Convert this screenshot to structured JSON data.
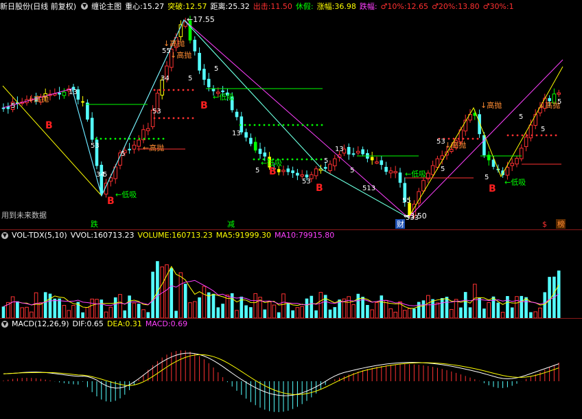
{
  "main_header": {
    "stock_name": "新日股份(日线 前复权)",
    "indicator": "缠论主图",
    "items": [
      {
        "label": "重心:",
        "value": "15.27",
        "color": "#ffffff"
      },
      {
        "label": "突破:",
        "value": "12.57",
        "color": "#ffff00"
      },
      {
        "label": "距离:",
        "value": "25.32",
        "color": "#ffffff"
      },
      {
        "label": "出击:",
        "value": "11.50",
        "color": "#ff3030"
      },
      {
        "label": "休假:",
        "value": "",
        "color": "#00ff00"
      },
      {
        "label": "涨幅:",
        "value": "36.98",
        "color": "#ffff00"
      },
      {
        "label": "跌幅:",
        "value": "",
        "color": "#ff40ff"
      },
      {
        "label": "♂10%:",
        "value": "12.65",
        "color": "#ff3030"
      },
      {
        "label": "♂20%:",
        "value": "13.80",
        "color": "#ff3030"
      },
      {
        "label": "♂30%:",
        "value": "1",
        "color": "#ff3030"
      }
    ]
  },
  "vol_header": {
    "name": "VOL-TDX(5,10)",
    "items": [
      {
        "label": "VVOL:",
        "value": "160713.23",
        "color": "#ffffff"
      },
      {
        "label": "VOLUME:",
        "value": "160713.23",
        "color": "#ffff00"
      },
      {
        "label": "MA5:",
        "value": "91999.30",
        "color": "#ffff00"
      },
      {
        "label": "MA10:",
        "value": "79915.80",
        "color": "#ff40ff"
      }
    ]
  },
  "macd_header": {
    "name": "MACD(12,26,9)",
    "items": [
      {
        "label": "DIF:",
        "value": "0.65",
        "color": "#ffffff"
      },
      {
        "label": "DEA:",
        "value": "0.31",
        "color": "#ffff00"
      },
      {
        "label": "MACD:",
        "value": "0.69",
        "color": "#ff40ff"
      }
    ]
  },
  "annotations": {
    "high_price": "17.55",
    "low_price": "3.50",
    "future_data": "用到未来数据",
    "high_sell": "高抛",
    "low_buy": "低吸",
    "buy": "B",
    "marks": [
      "跌",
      "减",
      "财",
      "$",
      "榜"
    ],
    "nums": [
      "5",
      "13",
      "34",
      "55",
      "53",
      "34",
      "513",
      "533"
    ]
  },
  "colors": {
    "up": "#ff3232",
    "down": "#54ffff",
    "yellow": "#ffff00",
    "green": "#00ff00",
    "magenta": "#ff40ff",
    "orange": "#ff8c32"
  },
  "chart_data": {
    "type": "candlestick",
    "price_range": [
      3.5,
      17.55
    ],
    "series": [
      {
        "name": "VOL-TDX(5,10)"
      },
      {
        "name": "MACD(12,26,9)"
      }
    ]
  }
}
